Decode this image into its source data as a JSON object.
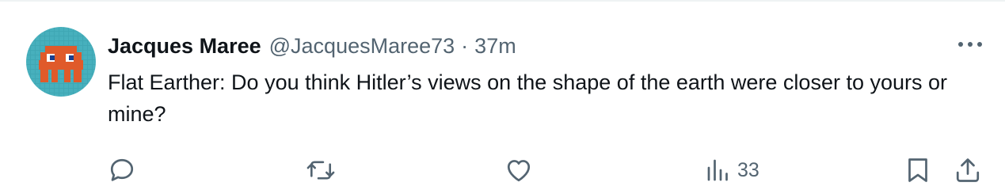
{
  "tweet": {
    "author_name": "Jacques Maree",
    "handle": "@JacquesMaree73",
    "separator": "·",
    "time": "37m",
    "text": "Flat Earther: Do you think Hitler’s views on the shape of the earth were closer to yours or mine?"
  },
  "actions": {
    "reply_icon": "reply-bubble-icon",
    "retweet_icon": "retweet-icon",
    "like_icon": "heart-icon",
    "views_icon": "bar-chart-icon",
    "views_count": "33",
    "bookmark_icon": "bookmark-icon",
    "share_icon": "share-upload-icon",
    "more_icon": "more-dots-icon"
  },
  "colors": {
    "text_primary": "#0f1419",
    "text_secondary": "#536471",
    "border": "#eff3f4",
    "avatar_bg": "#3fa7b4",
    "avatar_invader": "#e05a2a"
  }
}
